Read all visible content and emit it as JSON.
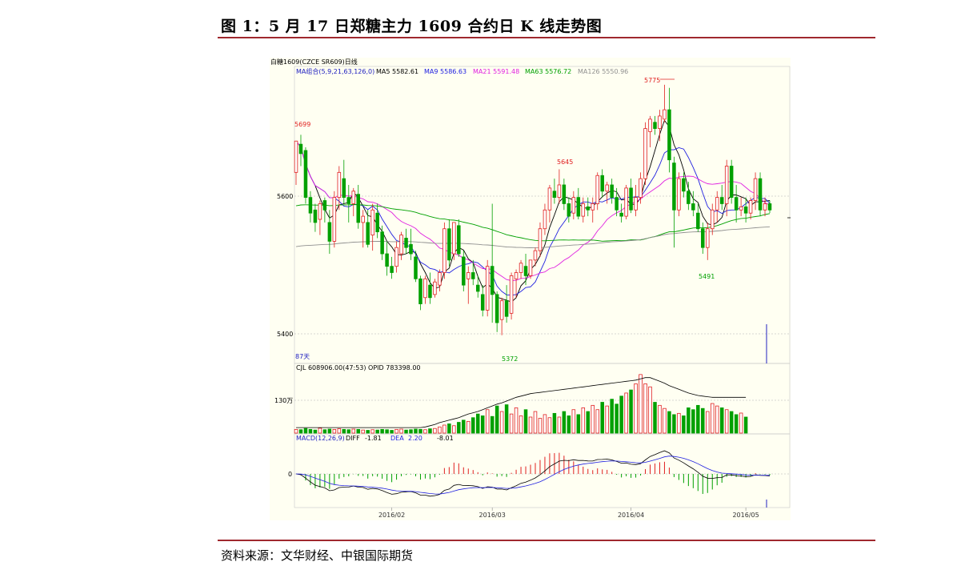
{
  "figure": {
    "title": "图 1：5 月 17 日郑糖主力 1609 合约日 K 线走势图",
    "source": "资料来源：文华财经、中银国际期货"
  },
  "colors": {
    "up": "#e02020",
    "down": "#00a000",
    "ma5": "#000000",
    "ma9": "#2020e0",
    "ma21": "#e020e0",
    "ma63": "#00a000",
    "ma126": "#909090"
  },
  "chart_data": {
    "type": "candlestick",
    "header": "白糖1609(CZCE SR609)日线",
    "ma_panel": {
      "label": "MA组合(5,9,21,63,126,0)",
      "items": [
        {
          "name": "MA5",
          "text": "MA5 5582.61"
        },
        {
          "name": "MA9",
          "text": "MA9 5586.63"
        },
        {
          "name": "MA21",
          "text": "MA21 5591.48"
        },
        {
          "name": "MA63",
          "text": "MA63 5576.72"
        },
        {
          "name": "MA126",
          "text": "MA126 5550.96"
        }
      ]
    },
    "price_ylim": [
      5340,
      5790
    ],
    "price_ticks": [
      "5600",
      "5400"
    ],
    "annotations": [
      {
        "text": "5699",
        "value": 5699
      },
      {
        "text": "5645",
        "value": 5645
      },
      {
        "text": "5775",
        "value": 5775
      },
      {
        "text": "5491",
        "value": 5491
      },
      {
        "text": "5372",
        "value": 5372
      }
    ],
    "days_label": "87天",
    "x_ticks": [
      "2016/02",
      "2016/03",
      "2016/04",
      "2016/05"
    ],
    "candles": [
      [
        5640,
        5690,
        5620,
        5690
      ],
      [
        5685,
        5700,
        5650,
        5670
      ],
      [
        5675,
        5680,
        5590,
        5600
      ],
      [
        5600,
        5610,
        5560,
        5575
      ],
      [
        5580,
        5590,
        5545,
        5560
      ],
      [
        5565,
        5595,
        5540,
        5590
      ],
      [
        5595,
        5600,
        5560,
        5580
      ],
      [
        5560,
        5580,
        5510,
        5530
      ],
      [
        5530,
        5610,
        5520,
        5600
      ],
      [
        5600,
        5650,
        5580,
        5640
      ],
      [
        5630,
        5660,
        5590,
        5600
      ],
      [
        5600,
        5620,
        5560,
        5590
      ],
      [
        5590,
        5615,
        5570,
        5610
      ],
      [
        5605,
        5620,
        5550,
        5560
      ],
      [
        5560,
        5580,
        5520,
        5570
      ],
      [
        5560,
        5580,
        5520,
        5525
      ],
      [
        5540,
        5590,
        5515,
        5580
      ],
      [
        5575,
        5590,
        5535,
        5545
      ],
      [
        5545,
        5555,
        5500,
        5510
      ],
      [
        5510,
        5530,
        5475,
        5490
      ],
      [
        5490,
        5505,
        5470,
        5480
      ],
      [
        5490,
        5530,
        5480,
        5520
      ],
      [
        5510,
        5545,
        5500,
        5540
      ],
      [
        5535,
        5550,
        5510,
        5520
      ],
      [
        5525,
        5550,
        5500,
        5510
      ],
      [
        5505,
        5515,
        5465,
        5470
      ],
      [
        5470,
        5475,
        5420,
        5430
      ],
      [
        5440,
        5475,
        5430,
        5470
      ],
      [
        5460,
        5480,
        5430,
        5440
      ],
      [
        5445,
        5470,
        5440,
        5465
      ],
      [
        5460,
        5485,
        5450,
        5480
      ],
      [
        5480,
        5560,
        5470,
        5550
      ],
      [
        5550,
        5565,
        5490,
        5500
      ],
      [
        5510,
        5560,
        5500,
        5560
      ],
      [
        5555,
        5565,
        5505,
        5510
      ],
      [
        5505,
        5515,
        5450,
        5460
      ],
      [
        5470,
        5490,
        5430,
        5480
      ],
      [
        5480,
        5500,
        5460,
        5470
      ],
      [
        5460,
        5475,
        5440,
        5450
      ],
      [
        5445,
        5460,
        5410,
        5420
      ],
      [
        5420,
        5500,
        5410,
        5490
      ],
      [
        5490,
        5590,
        5400,
        5445
      ],
      [
        5445,
        5450,
        5385,
        5400
      ],
      [
        5405,
        5440,
        5380,
        5435
      ],
      [
        5435,
        5460,
        5400,
        5410
      ],
      [
        5415,
        5480,
        5405,
        5475
      ],
      [
        5470,
        5485,
        5440,
        5480
      ],
      [
        5480,
        5500,
        5470,
        5495
      ],
      [
        5490,
        5510,
        5460,
        5475
      ],
      [
        5475,
        5500,
        5470,
        5500
      ],
      [
        5500,
        5520,
        5490,
        5515
      ],
      [
        5515,
        5560,
        5505,
        5550
      ],
      [
        5550,
        5590,
        5540,
        5580
      ],
      [
        5580,
        5620,
        5560,
        5615
      ],
      [
        5610,
        5630,
        5590,
        5600
      ],
      [
        5600,
        5645,
        5590,
        5620
      ],
      [
        5620,
        5630,
        5580,
        5590
      ],
      [
        5590,
        5600,
        5560,
        5570
      ],
      [
        5575,
        5610,
        5565,
        5600
      ],
      [
        5600,
        5615,
        5565,
        5570
      ],
      [
        5570,
        5600,
        5560,
        5590
      ],
      [
        5585,
        5600,
        5570,
        5580
      ],
      [
        5580,
        5600,
        5560,
        5590
      ],
      [
        5590,
        5640,
        5580,
        5635
      ],
      [
        5635,
        5645,
        5600,
        5610
      ],
      [
        5610,
        5625,
        5590,
        5620
      ],
      [
        5620,
        5630,
        5590,
        5600
      ],
      [
        5600,
        5615,
        5570,
        5580
      ],
      [
        5575,
        5590,
        5560,
        5570
      ],
      [
        5570,
        5620,
        5565,
        5615
      ],
      [
        5615,
        5630,
        5575,
        5580
      ],
      [
        5580,
        5620,
        5570,
        5600
      ],
      [
        5600,
        5640,
        5590,
        5630
      ],
      [
        5630,
        5720,
        5620,
        5710
      ],
      [
        5705,
        5730,
        5680,
        5725
      ],
      [
        5720,
        5730,
        5700,
        5710
      ],
      [
        5710,
        5740,
        5690,
        5730
      ],
      [
        5725,
        5780,
        5720,
        5740
      ],
      [
        5740,
        5775,
        5640,
        5660
      ],
      [
        5655,
        5665,
        5520,
        5580
      ],
      [
        5580,
        5640,
        5570,
        5630
      ],
      [
        5630,
        5640,
        5600,
        5610
      ],
      [
        5610,
        5625,
        5580,
        5590
      ],
      [
        5590,
        5610,
        5570,
        5580
      ],
      [
        5575,
        5590,
        5545,
        5550
      ],
      [
        5550,
        5560,
        5510,
        5520
      ],
      [
        5520,
        5560,
        5500,
        5550
      ],
      [
        5550,
        5590,
        5540,
        5580
      ],
      [
        5580,
        5610,
        5560,
        5600
      ],
      [
        5600,
        5620,
        5580,
        5590
      ],
      [
        5590,
        5660,
        5570,
        5650
      ],
      [
        5650,
        5660,
        5590,
        5600
      ],
      [
        5600,
        5620,
        5560,
        5580
      ],
      [
        5580,
        5600,
        5570,
        5585
      ],
      [
        5585,
        5600,
        5560,
        5575
      ],
      [
        5575,
        5600,
        5565,
        5595
      ],
      [
        5595,
        5640,
        5580,
        5630
      ],
      [
        5630,
        5640,
        5570,
        5580
      ],
      [
        5580,
        5600,
        5570,
        5590
      ],
      [
        5590,
        5595,
        5575,
        5580
      ]
    ],
    "volume_panel": {
      "label": "CJL  608906.00(47:53)   OPID  783398.00",
      "tick": "130万",
      "ylim": [
        0,
        2000000
      ],
      "volumes": [
        120000,
        110000,
        150000,
        120000,
        100000,
        160000,
        110000,
        130000,
        120000,
        140000,
        120000,
        110000,
        130000,
        120000,
        100000,
        90000,
        110000,
        100000,
        120000,
        110000,
        90000,
        120000,
        130000,
        100000,
        110000,
        130000,
        120000,
        110000,
        140000,
        150000,
        200000,
        260000,
        300000,
        240000,
        350000,
        420000,
        380000,
        500000,
        620000,
        560000,
        760000,
        540000,
        880000,
        700000,
        920000,
        620000,
        820000,
        560000,
        760000,
        520000,
        700000,
        480000,
        600000,
        500000,
        640000,
        520000,
        700000,
        560000,
        760000,
        600000,
        820000,
        700000,
        900000,
        760000,
        1000000,
        880000,
        1100000,
        940000,
        1200000,
        1300000,
        1400000,
        1600000,
        1900000,
        1600000,
        1500000,
        1000000,
        900000,
        800000,
        700000,
        600000,
        640000,
        560000,
        820000,
        760000,
        900000,
        800000,
        700000,
        960000,
        880000,
        820000,
        760000,
        700000,
        600000,
        650000,
        520000
      ],
      "opi": [
        180000,
        180000,
        180000,
        180000,
        180000,
        180000,
        180000,
        180000,
        180000,
        180000,
        180000,
        180000,
        180000,
        180000,
        180000,
        180000,
        180000,
        180000,
        180000,
        180000,
        180000,
        180000,
        180000,
        180000,
        180000,
        180000,
        180000,
        200000,
        240000,
        280000,
        340000,
        380000,
        420000,
        460000,
        500000,
        560000,
        620000,
        660000,
        700000,
        760000,
        820000,
        880000,
        940000,
        980000,
        1040000,
        1100000,
        1160000,
        1200000,
        1240000,
        1280000,
        1300000,
        1320000,
        1340000,
        1360000,
        1380000,
        1400000,
        1420000,
        1440000,
        1460000,
        1480000,
        1500000,
        1520000,
        1540000,
        1560000,
        1580000,
        1600000,
        1620000,
        1640000,
        1660000,
        1680000,
        1700000,
        1720000,
        1760000,
        1800000,
        1800000,
        1740000,
        1680000,
        1620000,
        1540000,
        1480000,
        1420000,
        1360000,
        1300000,
        1260000,
        1220000,
        1200000,
        1180000,
        1160000,
        1160000,
        1160000,
        1160000,
        1160000,
        1160000,
        1160000,
        1160000
      ]
    },
    "macd_panel": {
      "label": "MACD(12,26,9)",
      "diff_label": "DIFF",
      "diff_value": "-1.81",
      "dea_label": "DEA",
      "dea_value": "2.20",
      "macd_value": "-8.01",
      "tick": "0",
      "ylim": [
        -60,
        60
      ]
    }
  }
}
